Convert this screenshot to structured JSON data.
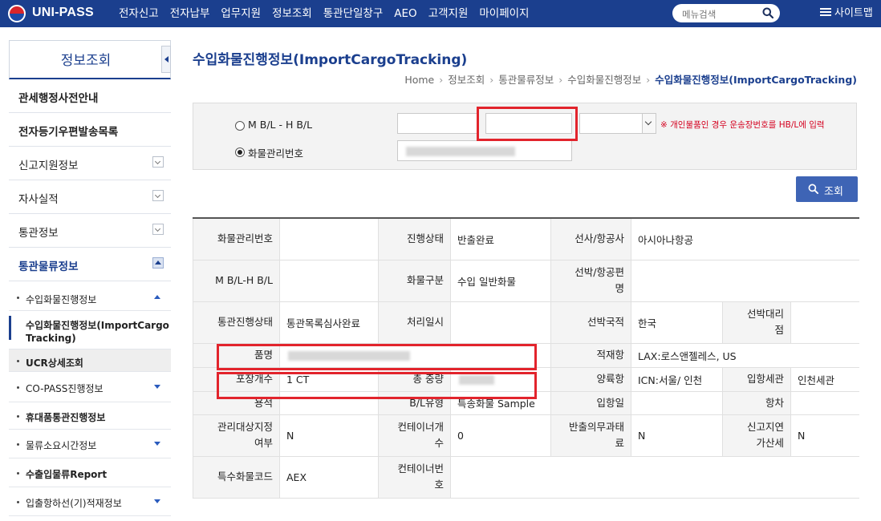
{
  "header": {
    "logo_text": "UNI-PASS",
    "nav": [
      "전자신고",
      "전자납부",
      "업무지원",
      "정보조회",
      "통관단일창구",
      "AEO",
      "고객지원",
      "마이페이지"
    ],
    "search_placeholder": "메뉴검색",
    "sitemap_label": "사이트맵"
  },
  "sidebar": {
    "title": "정보조회",
    "items": [
      {
        "label": "관세행정사전안내",
        "style": "bold"
      },
      {
        "label": "전자등기우편발송목록",
        "style": "bold"
      },
      {
        "label": "신고지원정보",
        "style": "normal"
      },
      {
        "label": "자사실적",
        "style": "normal"
      },
      {
        "label": "통관정보",
        "style": "normal"
      },
      {
        "label": "통관물류정보",
        "style": "active"
      }
    ],
    "sub_items": [
      {
        "label": "수입화물진행정보"
      },
      {
        "label": "수입화물진행정보(ImportCargo",
        "label2": "Tracking)"
      },
      {
        "label": "UCR상세조회"
      },
      {
        "label": "CO-PASS진행정보"
      },
      {
        "label": "휴대품통관진행정보"
      },
      {
        "label": "물류소요시간정보"
      },
      {
        "label": "수출입물류Report"
      },
      {
        "label": "입출항하선(기)적재정보"
      }
    ]
  },
  "main": {
    "title": "수입화물진행정보(ImportCargoTracking)",
    "breadcrumb": [
      "Home",
      "정보조회",
      "통관물류정보",
      "수입화물진행정보",
      "수입화물진행정보(ImportCargoTracking)"
    ],
    "breadcrumb_sep": "›",
    "search": {
      "radio_mbl": "M B/L - H B/L",
      "radio_cargo": "화물관리번호",
      "notice": "※ 개인물품인 경우 운송장번호를 HB/L에 입력",
      "query_button": "조회"
    },
    "table": {
      "r1": {
        "h1": "화물관리번호",
        "h2": "진행상태",
        "v2": "반출완료",
        "h3": "선사/항공사",
        "v3": "아시아나항공"
      },
      "r2": {
        "h1": "M B/L-H B/L",
        "h2": "화물구분",
        "v2": "수입 일반화물",
        "h3a": "선박/항공편",
        "h3b": "명"
      },
      "r3": {
        "h1": "통관진행상태",
        "v1": "통관목록심사완료",
        "h2": "처리일시",
        "h3": "선박국적",
        "v3": "한국",
        "h4a": "선박대리",
        "h4b": "점"
      },
      "r4": {
        "h1": "품명",
        "h3": "적재항",
        "v3": "LAX:로스앤젤레스, US"
      },
      "r5": {
        "h1": "포장개수",
        "v1": "1 CT",
        "h2": "총 중량",
        "h3": "양륙항",
        "v3": "ICN:서울/ 인천",
        "h4": "입항세관",
        "v4": "인천세관"
      },
      "r6": {
        "h1": "용적",
        "h2": "B/L유형",
        "v2": "특송화물 Sample",
        "h3": "입항일",
        "h4": "항차"
      },
      "r7": {
        "h1a": "관리대상지정",
        "h1b": "여부",
        "v1": "N",
        "h2a": "컨테이너개",
        "h2b": "수",
        "v2": "0",
        "h3a": "반출의무과태",
        "h3b": "료",
        "v3": "N",
        "h4a": "신고지연",
        "h4b": "가산세",
        "v4": "N"
      },
      "r8": {
        "h1": "특수화물코드",
        "v1": "AEX",
        "h2a": "컨테이너번",
        "h2b": "호"
      }
    }
  },
  "colors": {
    "brand": "#1b3f8e",
    "highlight": "#e2242c",
    "notice": "#d4001f",
    "button": "#3e64b5"
  }
}
